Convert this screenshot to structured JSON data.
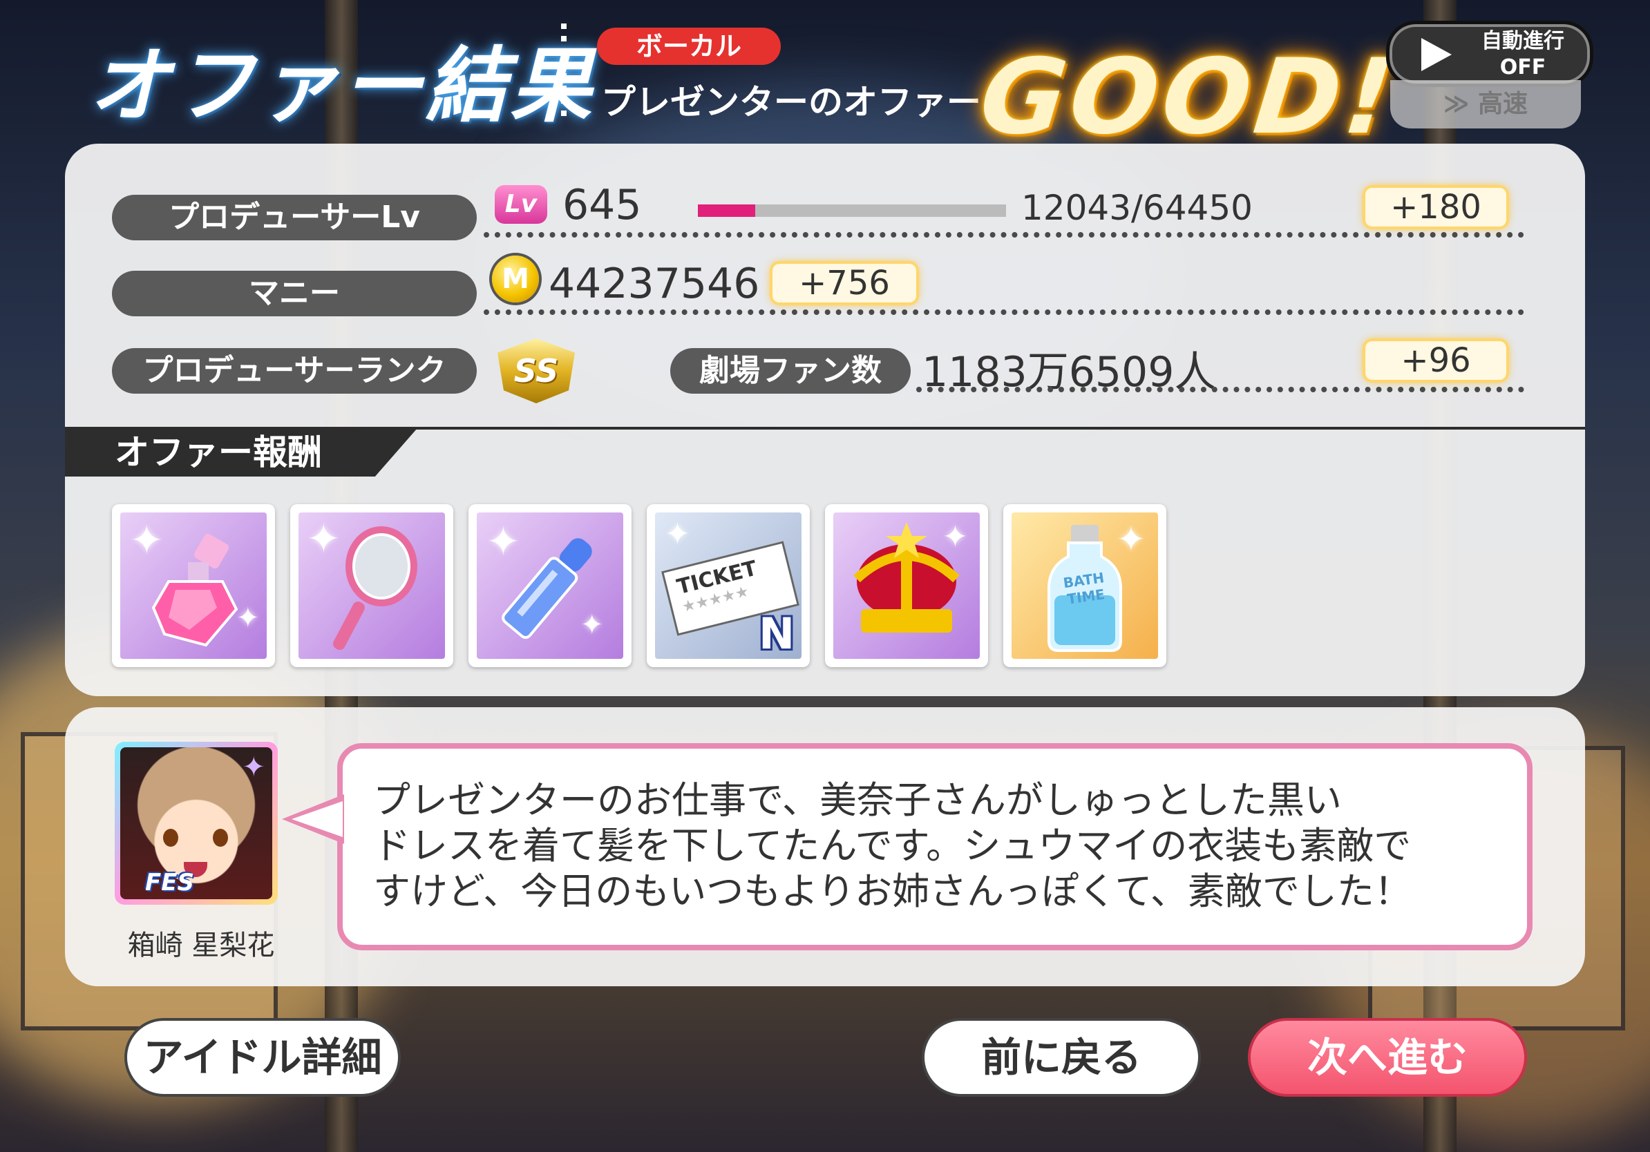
{
  "header": {
    "title": "オファー結果",
    "type_badge": "ボーカル",
    "offer_name": "プレゼンターのオファー",
    "result": "GOOD!",
    "auto_label_line1": "自動進行",
    "auto_label_line2": "OFF",
    "speed_label": "≫ 高速"
  },
  "stats": {
    "producer_lv_label": "プロデューサーLv",
    "lv_badge": "Lv",
    "level": "645",
    "exp_progress": 0.187,
    "exp_text": "12043/64450",
    "exp_gain": "+180",
    "money_label": "マニー",
    "coin_symbol": "M",
    "money": "44237546",
    "money_gain": "+756",
    "rank_label": "プロデューサーランク",
    "rank": "SS",
    "fans_label": "劇場ファン数",
    "fans": "1183万6509人",
    "fans_gain": "+96"
  },
  "rewards": {
    "title": "オファー報酬",
    "items": [
      {
        "icon": "perfume-bottle-icon",
        "bg": "purple"
      },
      {
        "icon": "hand-mirror-icon",
        "bg": "purple"
      },
      {
        "icon": "lipstick-icon",
        "bg": "purple"
      },
      {
        "icon": "ticket-icon",
        "bg": "blue",
        "ticket_text": "TICKET",
        "grade": "N"
      },
      {
        "icon": "crown-icon",
        "bg": "purple"
      },
      {
        "icon": "bath-salt-bottle-icon",
        "bg": "orange",
        "label": "BATH TIME"
      }
    ]
  },
  "dialog": {
    "avatar_badge": "FES",
    "speaker": "箱崎 星梨花",
    "message": "プレゼンターのお仕事で、美奈子さんがしゅっとした黒い\nドレスを着て髪を下してたんです。シュウマイの衣装も素敵で\nすけど、今日のもいつもよりお姉さんっぽくて、素敵でした！"
  },
  "buttons": {
    "idol_detail": "アイドル詳細",
    "back": "前に戻る",
    "next": "次へ進む"
  },
  "colors": {
    "accent_pink": "#f4546e",
    "exp_bar": "#e0207a",
    "badge_red": "#e5322f",
    "bubble_border": "#e889b2"
  }
}
